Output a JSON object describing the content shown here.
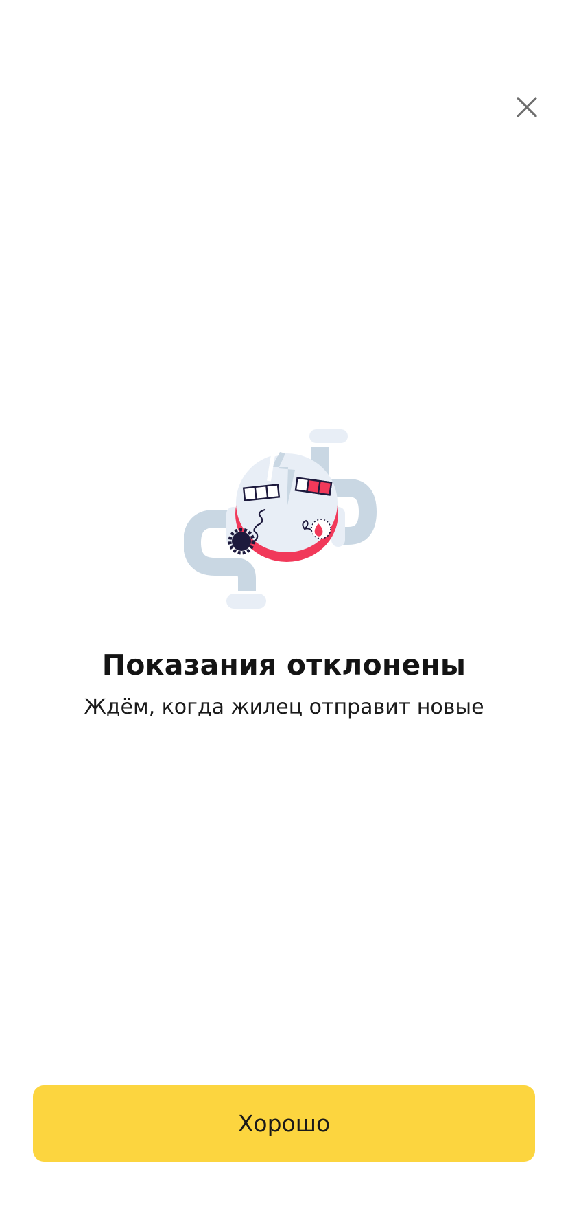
{
  "dialog": {
    "title": "Показания отклонены",
    "subtitle": "Ждём, когда жилец отправит новые",
    "primary_button_label": "Хорошо",
    "close_icon": "close-icon",
    "illustration_icon": "broken-meter-pipes-illustration"
  },
  "colors": {
    "accent_button": "#fcd53f",
    "illustration_red": "#f1395a",
    "illustration_pipe": "#c9d7e3",
    "illustration_light": "#e8eef6",
    "illustration_dark": "#1d1a3d"
  }
}
